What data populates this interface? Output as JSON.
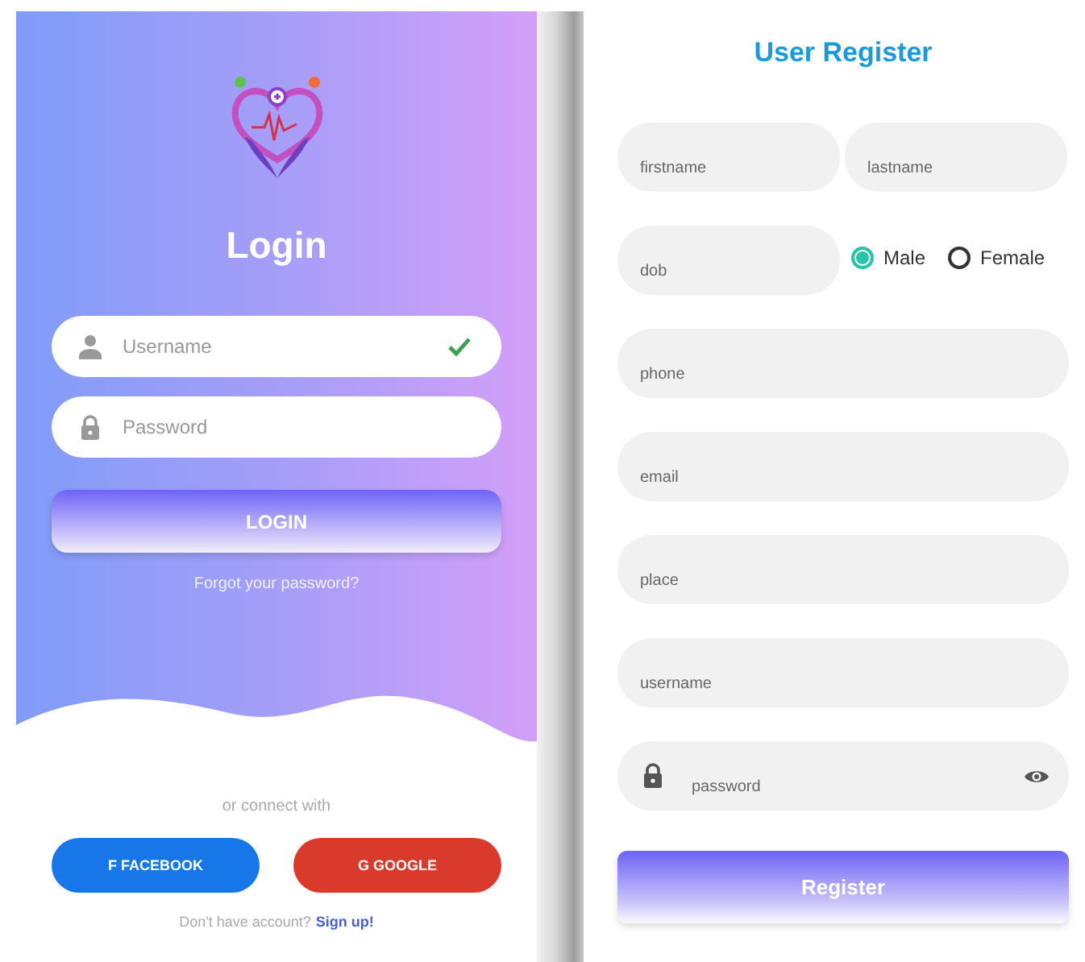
{
  "login": {
    "title": "Login",
    "fields": [
      {
        "kind": "user",
        "placeholder": "Username",
        "valid": true
      },
      {
        "kind": "lock",
        "placeholder": "Password",
        "valid": false
      }
    ],
    "submit": "LOGIN",
    "forgot": "Forgot your password?",
    "connect_text": "or connect with",
    "social_buttons": [
      {
        "label": "F FACEBOOK",
        "color": "#1877e8"
      },
      {
        "label": "G GOOGLE",
        "color": "#d93a2b"
      }
    ],
    "signup_prompt": "Don't have account?",
    "signup_link": "Sign up!"
  },
  "register": {
    "title": "User Register",
    "name_fields": [
      {
        "placeholder": "firstname"
      },
      {
        "placeholder": "lastname"
      }
    ],
    "dob": {
      "placeholder": "dob"
    },
    "gender": [
      {
        "label": "Male",
        "selected": true
      },
      {
        "label": "Female",
        "selected": false
      }
    ],
    "fields": [
      {
        "kind": "text",
        "placeholder": "phone"
      },
      {
        "kind": "text",
        "placeholder": "email"
      },
      {
        "kind": "text",
        "placeholder": "place"
      },
      {
        "kind": "text",
        "placeholder": "username"
      },
      {
        "kind": "password",
        "placeholder": "password"
      }
    ],
    "submit": "Register"
  }
}
